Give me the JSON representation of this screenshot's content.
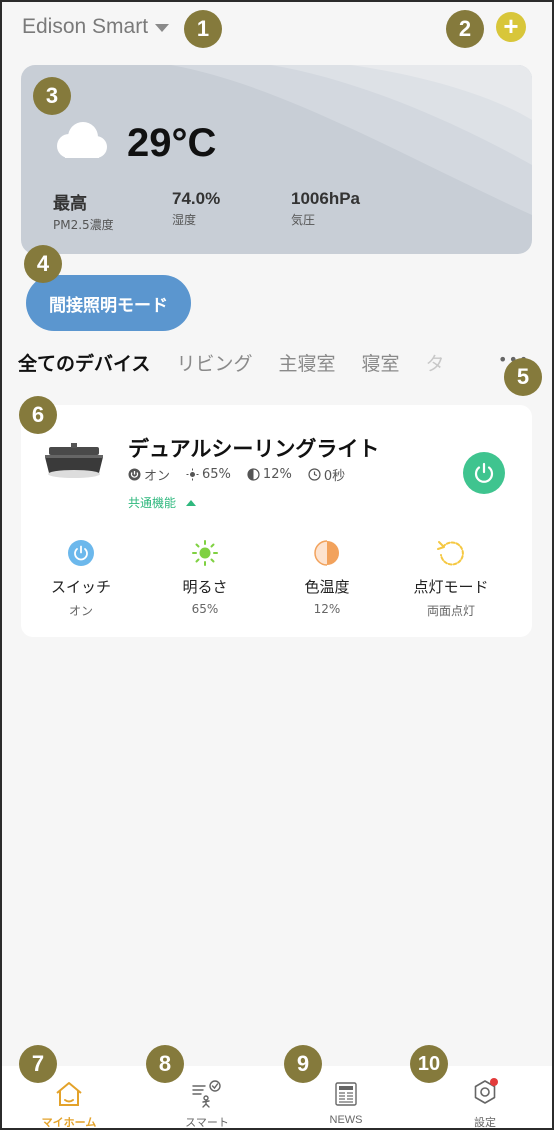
{
  "header": {
    "home_name": "Edison Smart",
    "add_icon": "plus-icon"
  },
  "weather": {
    "temperature": "29°C",
    "icon": "cloud-icon",
    "stats": [
      {
        "value": "最高",
        "label": "PM2.5濃度"
      },
      {
        "value": "74.0%",
        "label": "湿度"
      },
      {
        "value": "1006hPa",
        "label": "気圧"
      }
    ]
  },
  "scene": {
    "label": "間接照明モード"
  },
  "tabs": [
    "全てのデバイス",
    "リビング",
    "主寝室",
    "寝室",
    "タ"
  ],
  "device": {
    "name": "デュアルシーリングライト",
    "status": {
      "power": "オン",
      "brightness": "65%",
      "color_temp": "12%",
      "timer": "0秒"
    },
    "common_label": "共通機能",
    "functions": [
      {
        "name": "スイッチ",
        "value": "オン",
        "icon": "power-icon"
      },
      {
        "name": "明るさ",
        "value": "65%",
        "icon": "sun-icon"
      },
      {
        "name": "色温度",
        "value": "12%",
        "icon": "color-temp-icon"
      },
      {
        "name": "点灯モード",
        "value": "両面点灯",
        "icon": "refresh-icon"
      }
    ]
  },
  "nav": [
    {
      "label": "マイホーム",
      "icon": "home-icon",
      "active": true
    },
    {
      "label": "スマート",
      "icon": "smart-icon",
      "active": false
    },
    {
      "label": "NEWS",
      "icon": "news-icon",
      "active": false
    },
    {
      "label": "設定",
      "icon": "settings-icon",
      "active": false
    }
  ],
  "callouts": [
    "1",
    "2",
    "3",
    "4",
    "5",
    "6",
    "7",
    "8",
    "9",
    "10"
  ],
  "colors": {
    "accent": "#e3a22a",
    "scene_button": "#5b96cf",
    "power_on": "#3fc48f",
    "add_button": "#d8c63a",
    "callout": "#857a3c"
  }
}
